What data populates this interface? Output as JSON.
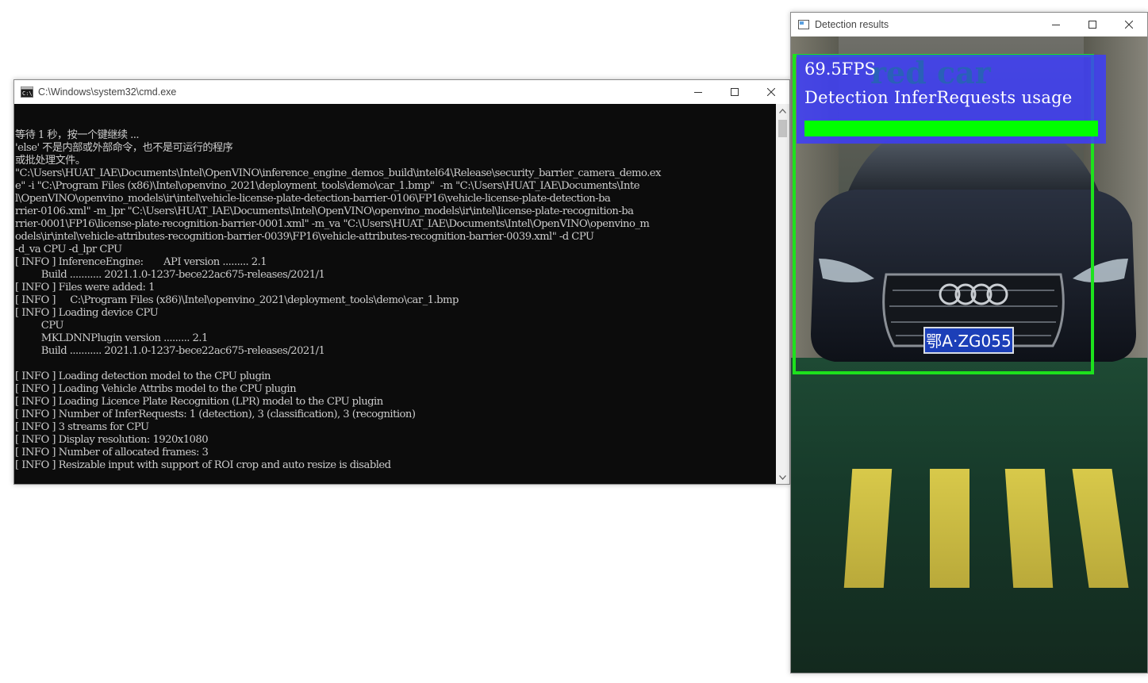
{
  "cmd_window": {
    "title": "C:\\Windows\\system32\\cmd.exe",
    "lines": [
      "等待 1 秒，按一个键继续 ...",
      "'else' 不是内部或外部命令，也不是可运行的程序",
      "或批处理文件。",
      "\"C:\\Users\\HUAT_IAE\\Documents\\Intel\\OpenVINO\\inference_engine_demos_build\\intel64\\Release\\security_barrier_camera_demo.ex",
      "e\" -i \"C:\\Program Files (x86)\\Intel\\openvino_2021\\deployment_tools\\demo\\car_1.bmp\"  -m \"C:\\Users\\HUAT_IAE\\Documents\\Inte",
      "l\\OpenVINO\\openvino_models\\ir\\intel\\vehicle-license-plate-detection-barrier-0106\\FP16\\vehicle-license-plate-detection-ba",
      "rrier-0106.xml\" -m_lpr \"C:\\Users\\HUAT_IAE\\Documents\\Intel\\OpenVINO\\openvino_models\\ir\\intel\\license-plate-recognition-ba",
      "rrier-0001\\FP16\\license-plate-recognition-barrier-0001.xml\" -m_va \"C:\\Users\\HUAT_IAE\\Documents\\Intel\\OpenVINO\\openvino_m",
      "odels\\ir\\intel\\vehicle-attributes-recognition-barrier-0039\\FP16\\vehicle-attributes-recognition-barrier-0039.xml\" -d CPU",
      "-d_va CPU -d_lpr CPU",
      "[ INFO ] InferenceEngine:       API version ......... 2.1",
      "         Build ........... 2021.1.0-1237-bece22ac675-releases/2021/1",
      "[ INFO ] Files were added: 1",
      "[ INFO ]     C:\\Program Files (x86)\\Intel\\openvino_2021\\deployment_tools\\demo\\car_1.bmp",
      "[ INFO ] Loading device CPU",
      "         CPU",
      "         MKLDNNPlugin version ......... 2.1",
      "         Build ........... 2021.1.0-1237-bece22ac675-releases/2021/1",
      "",
      "[ INFO ] Loading detection model to the CPU plugin",
      "[ INFO ] Loading Vehicle Attribs model to the CPU plugin",
      "[ INFO ] Loading Licence Plate Recognition (LPR) model to the CPU plugin",
      "[ INFO ] Number of InferRequests: 1 (detection), 3 (classification), 3 (recognition)",
      "[ INFO ] 3 streams for CPU",
      "[ INFO ] Display resolution: 1920x1080",
      "[ INFO ] Number of allocated frames: 3",
      "[ INFO ] Resizable input with support of ROI crop and auto resize is disabled"
    ]
  },
  "detection_window": {
    "title": "Detection results",
    "fps_text": "69.5FPS",
    "usage_text": "Detection InferRequests usage",
    "ghost_text": "red car",
    "plate_text": "鄂A·ZG055",
    "usage_fraction": 1.0
  },
  "colors": {
    "console_bg": "#0c0c0c",
    "console_fg": "#cccccc",
    "overlay_blue": "#3c3cff",
    "detection_green": "#1de21d",
    "usage_green": "#00ff00"
  }
}
